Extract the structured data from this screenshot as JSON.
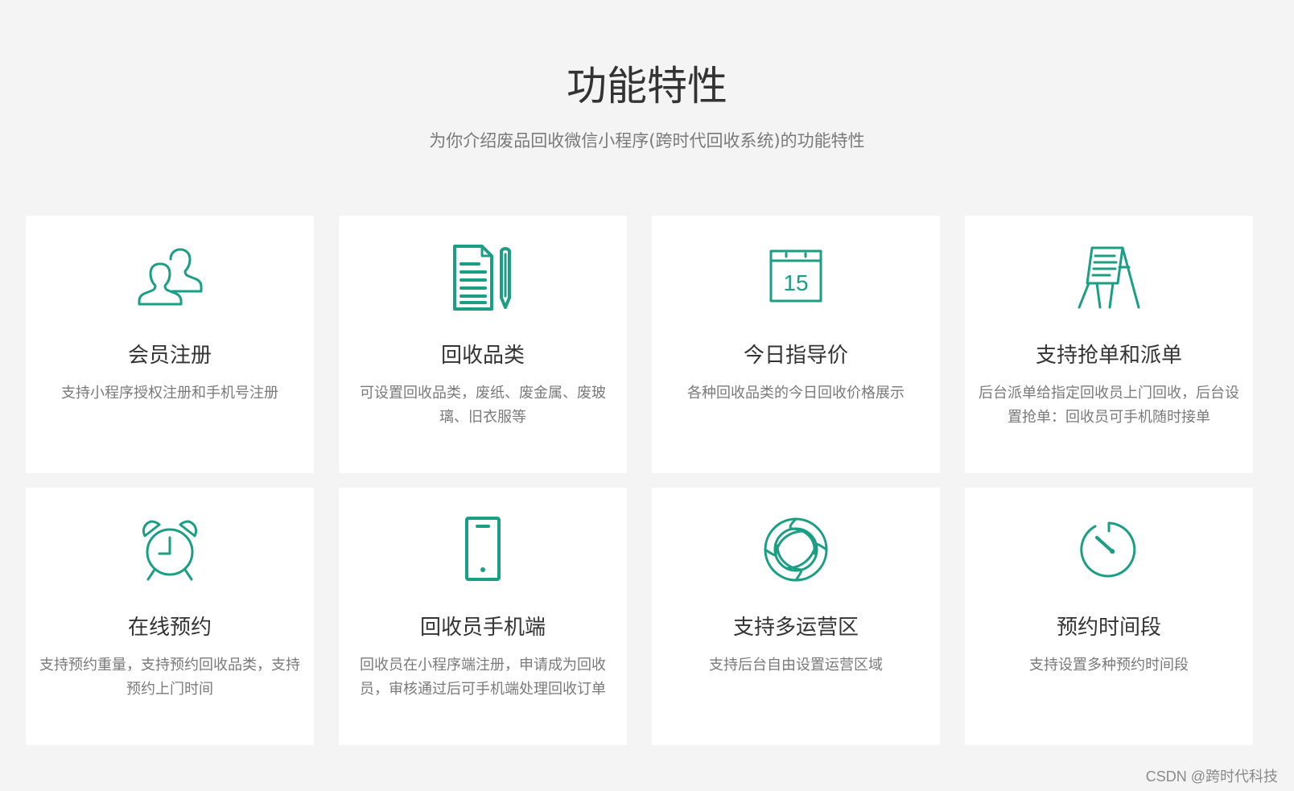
{
  "header": {
    "title": "功能特性",
    "subtitle": "为你介绍废品回收微信小程序(跨时代回收系统)的功能特性"
  },
  "accent_color": "#1a9f85",
  "features": [
    {
      "icon": "users-icon",
      "title": "会员注册",
      "desc": "支持小程序授权注册和手机号注册"
    },
    {
      "icon": "document-pencil-icon",
      "title": "回收品类",
      "desc": "可设置回收品类，废纸、废金属、废玻璃、旧衣服等"
    },
    {
      "icon": "calendar-icon",
      "title": "今日指导价",
      "desc": "各种回收品类的今日回收价格展示"
    },
    {
      "icon": "easel-board-icon",
      "title": "支持抢单和派单",
      "desc": "后台派单给指定回收员上门回收，后台设置抢单：回收员可手机随时接单"
    },
    {
      "icon": "alarm-clock-icon",
      "title": "在线预约",
      "desc": "支持预约重量，支持预约回收品类，支持预约上门时间"
    },
    {
      "icon": "mobile-phone-icon",
      "title": "回收员手机端",
      "desc": "回收员在小程序端注册，申请成为回收员，审核通过后可手机端处理回收订单"
    },
    {
      "icon": "aperture-icon",
      "title": "支持多运营区",
      "desc": "支持后台自由设置运营区域"
    },
    {
      "icon": "timer-icon",
      "title": "预约时间段",
      "desc": "支持设置多种预约时间段"
    }
  ],
  "calendar_day": "15",
  "watermark": "CSDN @跨时代科技"
}
